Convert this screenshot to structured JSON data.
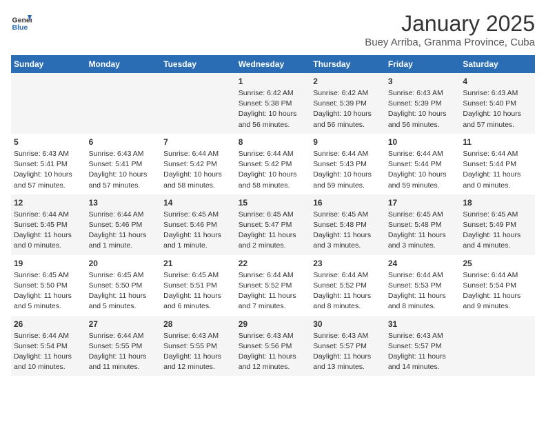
{
  "header": {
    "logo_general": "General",
    "logo_blue": "Blue",
    "title": "January 2025",
    "subtitle": "Buey Arriba, Granma Province, Cuba"
  },
  "weekdays": [
    "Sunday",
    "Monday",
    "Tuesday",
    "Wednesday",
    "Thursday",
    "Friday",
    "Saturday"
  ],
  "weeks": [
    [
      {
        "day": "",
        "info": ""
      },
      {
        "day": "",
        "info": ""
      },
      {
        "day": "",
        "info": ""
      },
      {
        "day": "1",
        "info": "Sunrise: 6:42 AM\nSunset: 5:38 PM\nDaylight: 10 hours\nand 56 minutes."
      },
      {
        "day": "2",
        "info": "Sunrise: 6:42 AM\nSunset: 5:39 PM\nDaylight: 10 hours\nand 56 minutes."
      },
      {
        "day": "3",
        "info": "Sunrise: 6:43 AM\nSunset: 5:39 PM\nDaylight: 10 hours\nand 56 minutes."
      },
      {
        "day": "4",
        "info": "Sunrise: 6:43 AM\nSunset: 5:40 PM\nDaylight: 10 hours\nand 57 minutes."
      }
    ],
    [
      {
        "day": "5",
        "info": "Sunrise: 6:43 AM\nSunset: 5:41 PM\nDaylight: 10 hours\nand 57 minutes."
      },
      {
        "day": "6",
        "info": "Sunrise: 6:43 AM\nSunset: 5:41 PM\nDaylight: 10 hours\nand 57 minutes."
      },
      {
        "day": "7",
        "info": "Sunrise: 6:44 AM\nSunset: 5:42 PM\nDaylight: 10 hours\nand 58 minutes."
      },
      {
        "day": "8",
        "info": "Sunrise: 6:44 AM\nSunset: 5:42 PM\nDaylight: 10 hours\nand 58 minutes."
      },
      {
        "day": "9",
        "info": "Sunrise: 6:44 AM\nSunset: 5:43 PM\nDaylight: 10 hours\nand 59 minutes."
      },
      {
        "day": "10",
        "info": "Sunrise: 6:44 AM\nSunset: 5:44 PM\nDaylight: 10 hours\nand 59 minutes."
      },
      {
        "day": "11",
        "info": "Sunrise: 6:44 AM\nSunset: 5:44 PM\nDaylight: 11 hours\nand 0 minutes."
      }
    ],
    [
      {
        "day": "12",
        "info": "Sunrise: 6:44 AM\nSunset: 5:45 PM\nDaylight: 11 hours\nand 0 minutes."
      },
      {
        "day": "13",
        "info": "Sunrise: 6:44 AM\nSunset: 5:46 PM\nDaylight: 11 hours\nand 1 minute."
      },
      {
        "day": "14",
        "info": "Sunrise: 6:45 AM\nSunset: 5:46 PM\nDaylight: 11 hours\nand 1 minute."
      },
      {
        "day": "15",
        "info": "Sunrise: 6:45 AM\nSunset: 5:47 PM\nDaylight: 11 hours\nand 2 minutes."
      },
      {
        "day": "16",
        "info": "Sunrise: 6:45 AM\nSunset: 5:48 PM\nDaylight: 11 hours\nand 3 minutes."
      },
      {
        "day": "17",
        "info": "Sunrise: 6:45 AM\nSunset: 5:48 PM\nDaylight: 11 hours\nand 3 minutes."
      },
      {
        "day": "18",
        "info": "Sunrise: 6:45 AM\nSunset: 5:49 PM\nDaylight: 11 hours\nand 4 minutes."
      }
    ],
    [
      {
        "day": "19",
        "info": "Sunrise: 6:45 AM\nSunset: 5:50 PM\nDaylight: 11 hours\nand 5 minutes."
      },
      {
        "day": "20",
        "info": "Sunrise: 6:45 AM\nSunset: 5:50 PM\nDaylight: 11 hours\nand 5 minutes."
      },
      {
        "day": "21",
        "info": "Sunrise: 6:45 AM\nSunset: 5:51 PM\nDaylight: 11 hours\nand 6 minutes."
      },
      {
        "day": "22",
        "info": "Sunrise: 6:44 AM\nSunset: 5:52 PM\nDaylight: 11 hours\nand 7 minutes."
      },
      {
        "day": "23",
        "info": "Sunrise: 6:44 AM\nSunset: 5:52 PM\nDaylight: 11 hours\nand 8 minutes."
      },
      {
        "day": "24",
        "info": "Sunrise: 6:44 AM\nSunset: 5:53 PM\nDaylight: 11 hours\nand 8 minutes."
      },
      {
        "day": "25",
        "info": "Sunrise: 6:44 AM\nSunset: 5:54 PM\nDaylight: 11 hours\nand 9 minutes."
      }
    ],
    [
      {
        "day": "26",
        "info": "Sunrise: 6:44 AM\nSunset: 5:54 PM\nDaylight: 11 hours\nand 10 minutes."
      },
      {
        "day": "27",
        "info": "Sunrise: 6:44 AM\nSunset: 5:55 PM\nDaylight: 11 hours\nand 11 minutes."
      },
      {
        "day": "28",
        "info": "Sunrise: 6:43 AM\nSunset: 5:55 PM\nDaylight: 11 hours\nand 12 minutes."
      },
      {
        "day": "29",
        "info": "Sunrise: 6:43 AM\nSunset: 5:56 PM\nDaylight: 11 hours\nand 12 minutes."
      },
      {
        "day": "30",
        "info": "Sunrise: 6:43 AM\nSunset: 5:57 PM\nDaylight: 11 hours\nand 13 minutes."
      },
      {
        "day": "31",
        "info": "Sunrise: 6:43 AM\nSunset: 5:57 PM\nDaylight: 11 hours\nand 14 minutes."
      },
      {
        "day": "",
        "info": ""
      }
    ]
  ]
}
